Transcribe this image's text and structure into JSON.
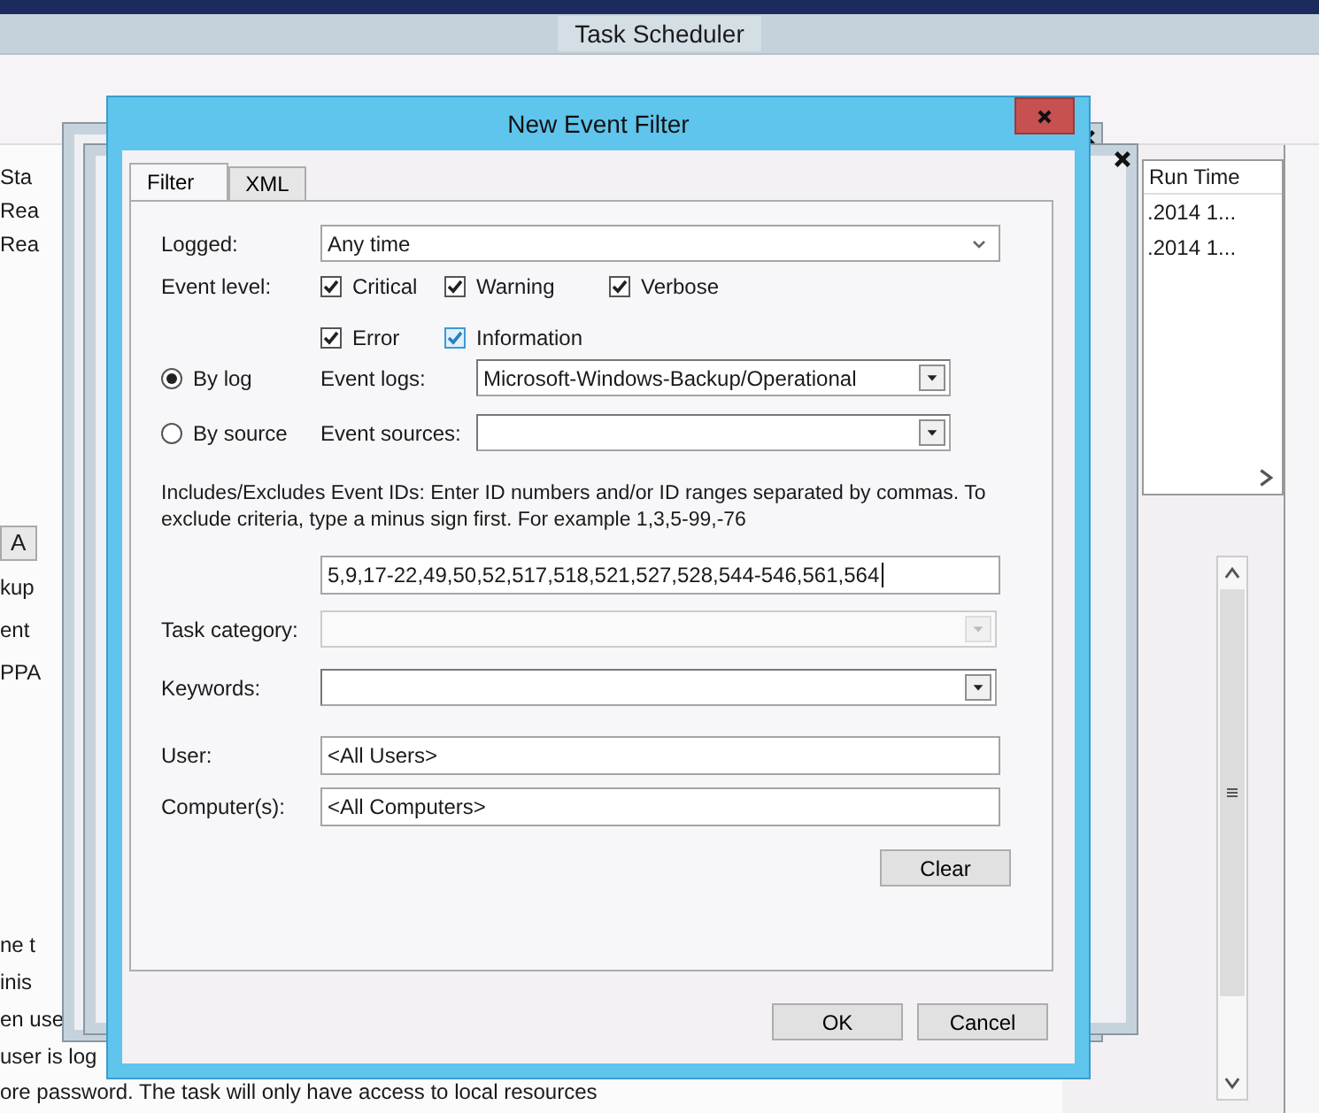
{
  "background_window": {
    "title": "Task Scheduler",
    "top_fragments": [
      "Sta",
      "Rea",
      "Rea"
    ],
    "run_time_column": {
      "header": "Run Time",
      "cells": [
        ".2014 1...",
        ".2014 1..."
      ]
    },
    "middle_tab": "A",
    "middle_fragments": [
      "kup",
      "ent",
      "PPA"
    ],
    "bottom_fragments": [
      "ne t",
      "inis",
      "en use",
      "user is log"
    ],
    "status_text": "ore password.  The task will only have access to local resources"
  },
  "dialog": {
    "title": "New Event Filter",
    "tabs": [
      {
        "label": "Filter",
        "selected": true
      },
      {
        "label": "XML",
        "selected": false
      }
    ],
    "logged": {
      "label": "Logged:",
      "value": "Any time"
    },
    "event_level": {
      "label": "Event level:",
      "options": [
        {
          "label": "Critical",
          "checked": true,
          "focused": false
        },
        {
          "label": "Warning",
          "checked": true,
          "focused": false
        },
        {
          "label": "Verbose",
          "checked": true,
          "focused": false
        },
        {
          "label": "Error",
          "checked": true,
          "focused": false
        },
        {
          "label": "Information",
          "checked": true,
          "focused": true
        }
      ]
    },
    "sources": [
      {
        "label": "By log",
        "selected": true,
        "field_label": "Event logs:",
        "value": "Microsoft-Windows-Backup/Operational"
      },
      {
        "label": "By source",
        "selected": false,
        "field_label": "Event sources:"
      }
    ],
    "event_ids": {
      "description": "Includes/Excludes Event IDs: Enter ID numbers and/or ID ranges separated by commas. To exclude criteria, type a minus sign first. For example 1,3,5-99,-76",
      "value": "5,9,17-22,49,50,52,517,518,521,527,528,544-546,561,564"
    },
    "task_category": {
      "label": "Task category:",
      "disabled": true
    },
    "keywords": {
      "label": "Keywords:",
      "disabled": false
    },
    "user": {
      "label": "User:",
      "value": "<All Users>"
    },
    "computers": {
      "label": "Computer(s):",
      "value": "<All Computers>"
    },
    "buttons": {
      "clear": "Clear",
      "ok": "OK",
      "cancel": "Cancel"
    }
  }
}
